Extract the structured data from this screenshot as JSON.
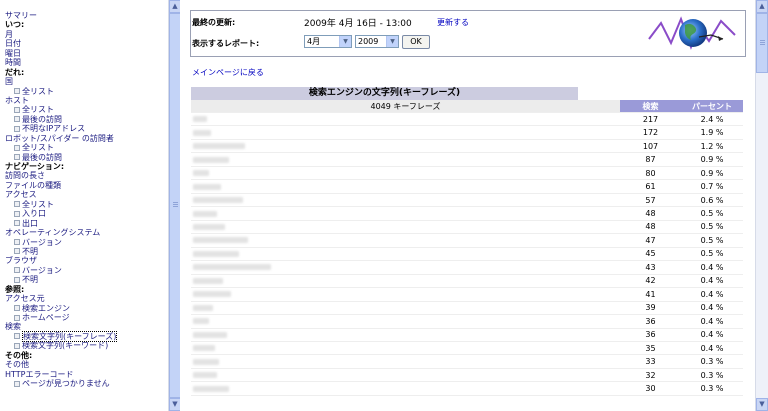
{
  "sidebar": {
    "items": [
      {
        "label": "サマリー",
        "type": "link",
        "indent": 0
      },
      {
        "label": "いつ:",
        "type": "head",
        "indent": 0
      },
      {
        "label": "月",
        "type": "link",
        "indent": 0
      },
      {
        "label": "日付",
        "type": "link",
        "indent": 0
      },
      {
        "label": "曜日",
        "type": "link",
        "indent": 0
      },
      {
        "label": "時間",
        "type": "link",
        "indent": 0
      },
      {
        "label": "だれ:",
        "type": "head",
        "indent": 0
      },
      {
        "label": "国",
        "type": "link",
        "indent": 0
      },
      {
        "label": "全リスト",
        "type": "link",
        "indent": 1
      },
      {
        "label": "ホスト",
        "type": "link",
        "indent": 0
      },
      {
        "label": "全リスト",
        "type": "link",
        "indent": 1
      },
      {
        "label": "最後の訪問",
        "type": "link",
        "indent": 1
      },
      {
        "label": "不明なIPアドレス",
        "type": "link",
        "indent": 1
      },
      {
        "label": "ロボット/スパイダー の訪問者",
        "type": "link",
        "indent": 0
      },
      {
        "label": "全リスト",
        "type": "link",
        "indent": 1
      },
      {
        "label": "最後の訪問",
        "type": "link",
        "indent": 1
      },
      {
        "label": "ナビゲーション:",
        "type": "head",
        "indent": 0
      },
      {
        "label": "訪問の長さ",
        "type": "link",
        "indent": 0
      },
      {
        "label": "ファイルの種類",
        "type": "link",
        "indent": 0
      },
      {
        "label": "アクセス",
        "type": "link",
        "indent": 0
      },
      {
        "label": "全リスト",
        "type": "link",
        "indent": 1
      },
      {
        "label": "入り口",
        "type": "link",
        "indent": 1
      },
      {
        "label": "出口",
        "type": "link",
        "indent": 1
      },
      {
        "label": "オペレーティングシステム",
        "type": "link",
        "indent": 0
      },
      {
        "label": "バージョン",
        "type": "link",
        "indent": 1
      },
      {
        "label": "不明",
        "type": "link",
        "indent": 1
      },
      {
        "label": "ブラウザ",
        "type": "link",
        "indent": 0
      },
      {
        "label": "バージョン",
        "type": "link",
        "indent": 1
      },
      {
        "label": "不明",
        "type": "link",
        "indent": 1
      },
      {
        "label": "参照:",
        "type": "head",
        "indent": 0
      },
      {
        "label": "アクセス元",
        "type": "link",
        "indent": 0
      },
      {
        "label": "検索エンジン",
        "type": "link",
        "indent": 1
      },
      {
        "label": "ホームページ",
        "type": "link",
        "indent": 1
      },
      {
        "label": "検索",
        "type": "link",
        "indent": 0
      },
      {
        "label": "検索文字列(キーフレーズ)",
        "type": "link",
        "indent": 1,
        "active": true
      },
      {
        "label": "検索文字列(キーワード)",
        "type": "link",
        "indent": 1
      },
      {
        "label": "その他:",
        "type": "head",
        "indent": 0
      },
      {
        "label": "その他",
        "type": "link",
        "indent": 0
      },
      {
        "label": "HTTPエラーコード",
        "type": "link",
        "indent": 0
      },
      {
        "label": "ページが見つかりません",
        "type": "link",
        "indent": 1
      }
    ]
  },
  "info": {
    "last_update_label": "最終の更新:",
    "last_update_value": "2009年 4月 16日 - 13:00",
    "update_link": "更新する",
    "report_label": "表示するレポート:",
    "month_value": "4月",
    "year_value": "2009",
    "ok_label": "OK"
  },
  "back_link": "メインページに戻る",
  "table": {
    "title": "検索エンジンの文字列(キーフレーズ)",
    "count_header": "4049 キーフレーズ",
    "col_hits": "検索",
    "col_pct": "パーセント",
    "rows": [
      {
        "hits": "217",
        "pct": "2.4 %",
        "w": 14
      },
      {
        "hits": "172",
        "pct": "1.9 %",
        "w": 18
      },
      {
        "hits": "107",
        "pct": "1.2 %",
        "w": 52
      },
      {
        "hits": "87",
        "pct": "0.9 %",
        "w": 36
      },
      {
        "hits": "80",
        "pct": "0.9 %",
        "w": 16
      },
      {
        "hits": "61",
        "pct": "0.7 %",
        "w": 28
      },
      {
        "hits": "57",
        "pct": "0.6 %",
        "w": 50
      },
      {
        "hits": "48",
        "pct": "0.5 %",
        "w": 24
      },
      {
        "hits": "48",
        "pct": "0.5 %",
        "w": 32
      },
      {
        "hits": "47",
        "pct": "0.5 %",
        "w": 55
      },
      {
        "hits": "45",
        "pct": "0.5 %",
        "w": 46
      },
      {
        "hits": "43",
        "pct": "0.4 %",
        "w": 78
      },
      {
        "hits": "42",
        "pct": "0.4 %",
        "w": 30
      },
      {
        "hits": "41",
        "pct": "0.4 %",
        "w": 38
      },
      {
        "hits": "39",
        "pct": "0.4 %",
        "w": 20
      },
      {
        "hits": "36",
        "pct": "0.4 %",
        "w": 16
      },
      {
        "hits": "36",
        "pct": "0.4 %",
        "w": 34
      },
      {
        "hits": "35",
        "pct": "0.4 %",
        "w": 22
      },
      {
        "hits": "33",
        "pct": "0.3 %",
        "w": 26
      },
      {
        "hits": "32",
        "pct": "0.3 %",
        "w": 24
      },
      {
        "hits": "30",
        "pct": "0.3 %",
        "w": 36
      }
    ]
  }
}
